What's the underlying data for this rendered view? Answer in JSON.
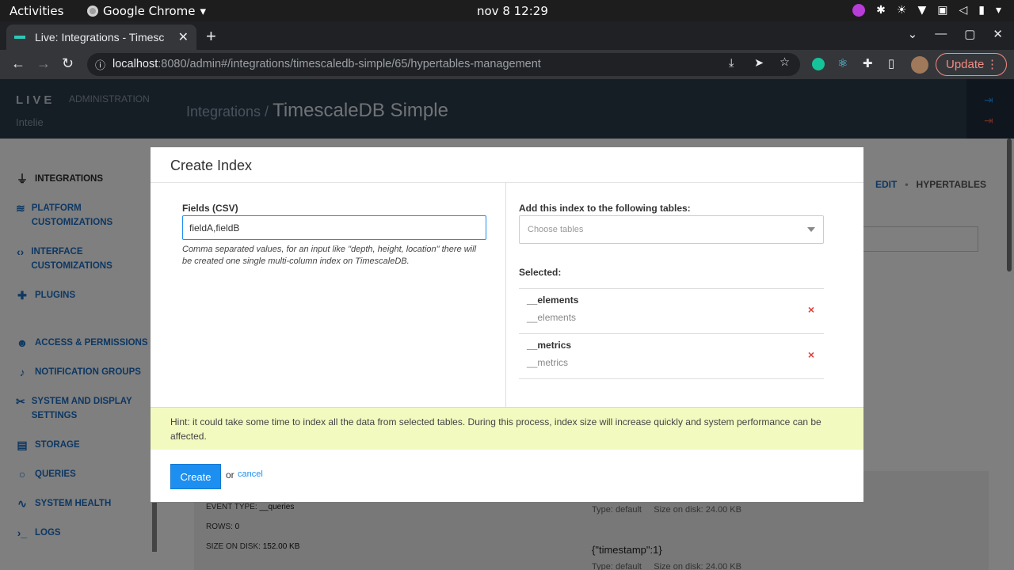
{
  "os_bar": {
    "activities": "Activities",
    "app_name": "Google Chrome",
    "clock": "nov 8  12:29"
  },
  "browser": {
    "tab_title": "Live: Integrations - Timesc",
    "url_host": "localhost",
    "url_rest": ":8080/admin#/integrations/timescaledb-simple/65/hypertables-management",
    "update_label": "Update"
  },
  "app": {
    "brand": "LIVE",
    "section": "ADMINISTRATION",
    "org": "Intelie",
    "breadcrumb_parent": "Integrations /",
    "breadcrumb_current": "TimescaleDB Simple",
    "tab_edit": "EDIT",
    "tab_separator": "•",
    "tab_hypertables": "HYPERTABLES"
  },
  "sidebar": {
    "items": [
      {
        "label": "INTEGRATIONS",
        "icon": "plug-icon"
      },
      {
        "label": "PLATFORM CUSTOMIZATIONS",
        "icon": "layers-icon"
      },
      {
        "label": "INTERFACE CUSTOMIZATIONS",
        "icon": "code-icon"
      },
      {
        "label": "PLUGINS",
        "icon": "puzzle-icon"
      },
      {
        "label": "ACCESS & PERMISSIONS",
        "icon": "users-icon"
      },
      {
        "label": "NOTIFICATION GROUPS",
        "icon": "bell-icon"
      },
      {
        "label": "SYSTEM AND DISPLAY SETTINGS",
        "icon": "tools-icon"
      },
      {
        "label": "STORAGE",
        "icon": "database-icon"
      },
      {
        "label": "QUERIES",
        "icon": "search-icon"
      },
      {
        "label": "SYSTEM HEALTH",
        "icon": "pulse-icon"
      },
      {
        "label": "LOGS",
        "icon": "terminal-icon"
      }
    ]
  },
  "background": {
    "event_type_label": "EVENT TYPE:",
    "event_type_value": "__queries",
    "rows_label": "ROWS:",
    "rows_value": "0",
    "size_label": "SIZE ON DISK:",
    "size_value": "152.00 KB",
    "idx1_type": "Type: default",
    "idx1_size": "Size on disk: 24.00 KB",
    "idx2_name": "{\"timestamp\":1}",
    "idx2_type": "Type: default",
    "idx2_size": "Size on disk: 24.00 KB"
  },
  "modal": {
    "title": "Create Index",
    "fields_label": "Fields (CSV)",
    "fields_value": "fieldA,fieldB",
    "fields_help": "Comma separated values, for an input like \"depth, height, location\" there will be created one single multi-column index on TimescaleDB.",
    "tables_label": "Add this index to the following tables:",
    "tables_placeholder": "Choose tables",
    "selected_label": "Selected:",
    "selected": [
      {
        "name": "__elements",
        "sub": "__elements"
      },
      {
        "name": "__metrics",
        "sub": "__metrics"
      }
    ],
    "remove_symbol": "×",
    "hint": "Hint: it could take some time to index all the data from selected tables. During this process, index size will increase quickly and system performance can be affected.",
    "create_label": "Create",
    "or_text": "or",
    "cancel_label": "cancel"
  }
}
